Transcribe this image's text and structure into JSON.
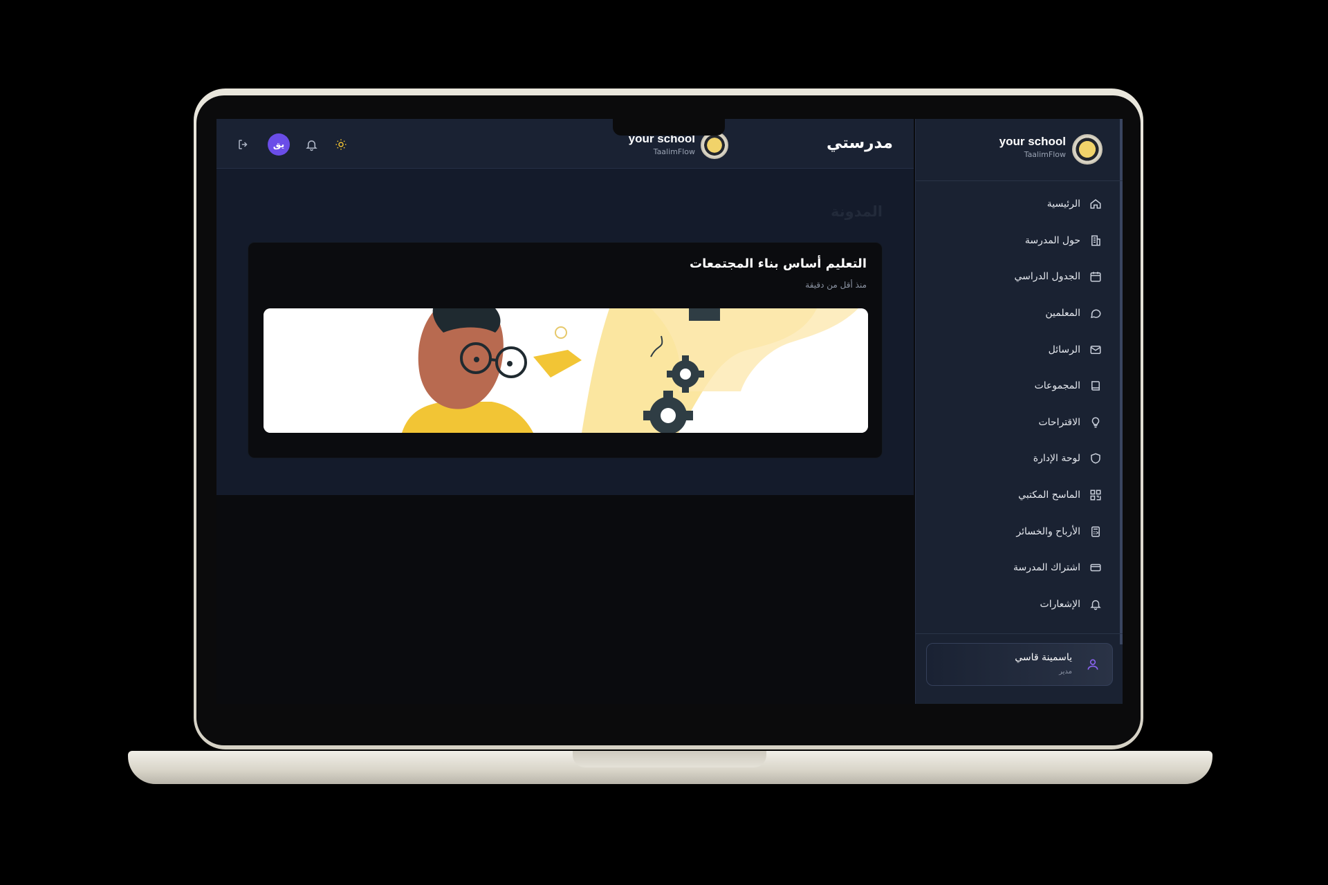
{
  "topbar": {
    "brand_name": "your school",
    "brand_sub": "TaalimFlow",
    "avatar_initials": "يق",
    "page_heading": "مدرستي"
  },
  "main": {
    "section_title": "المدونة",
    "post": {
      "title": "التعليم أساس بناء المجتمعات",
      "time": "منذ أقل من دقيقة"
    }
  },
  "sidebar": {
    "brand_name": "your school",
    "brand_sub": "TaalimFlow",
    "items": [
      {
        "label": "الرئيسية",
        "icon": "home-icon"
      },
      {
        "label": "حول المدرسة",
        "icon": "building-icon"
      },
      {
        "label": "الجدول الدراسي",
        "icon": "calendar-icon"
      },
      {
        "label": "المعلمين",
        "icon": "chat-icon"
      },
      {
        "label": "الرسائل",
        "icon": "mail-icon"
      },
      {
        "label": "المجموعات",
        "icon": "book-icon"
      },
      {
        "label": "الاقتراحات",
        "icon": "lightbulb-icon"
      },
      {
        "label": "لوحة الإدارة",
        "icon": "shield-icon"
      },
      {
        "label": "الماسح المكتبي",
        "icon": "qr-icon"
      },
      {
        "label": "الأرباح والخسائر",
        "icon": "calculator-icon"
      },
      {
        "label": "اشتراك المدرسة",
        "icon": "credit-card-icon"
      },
      {
        "label": "الإشعارات",
        "icon": "bell-icon"
      }
    ],
    "user": {
      "name": "ياسمينة قاسي",
      "role": "مدير"
    }
  },
  "colors": {
    "accent": "#6a4de8",
    "sun": "#f1c232",
    "sidebar_bg": "#1a2232",
    "header_bg": "#1a2233"
  }
}
